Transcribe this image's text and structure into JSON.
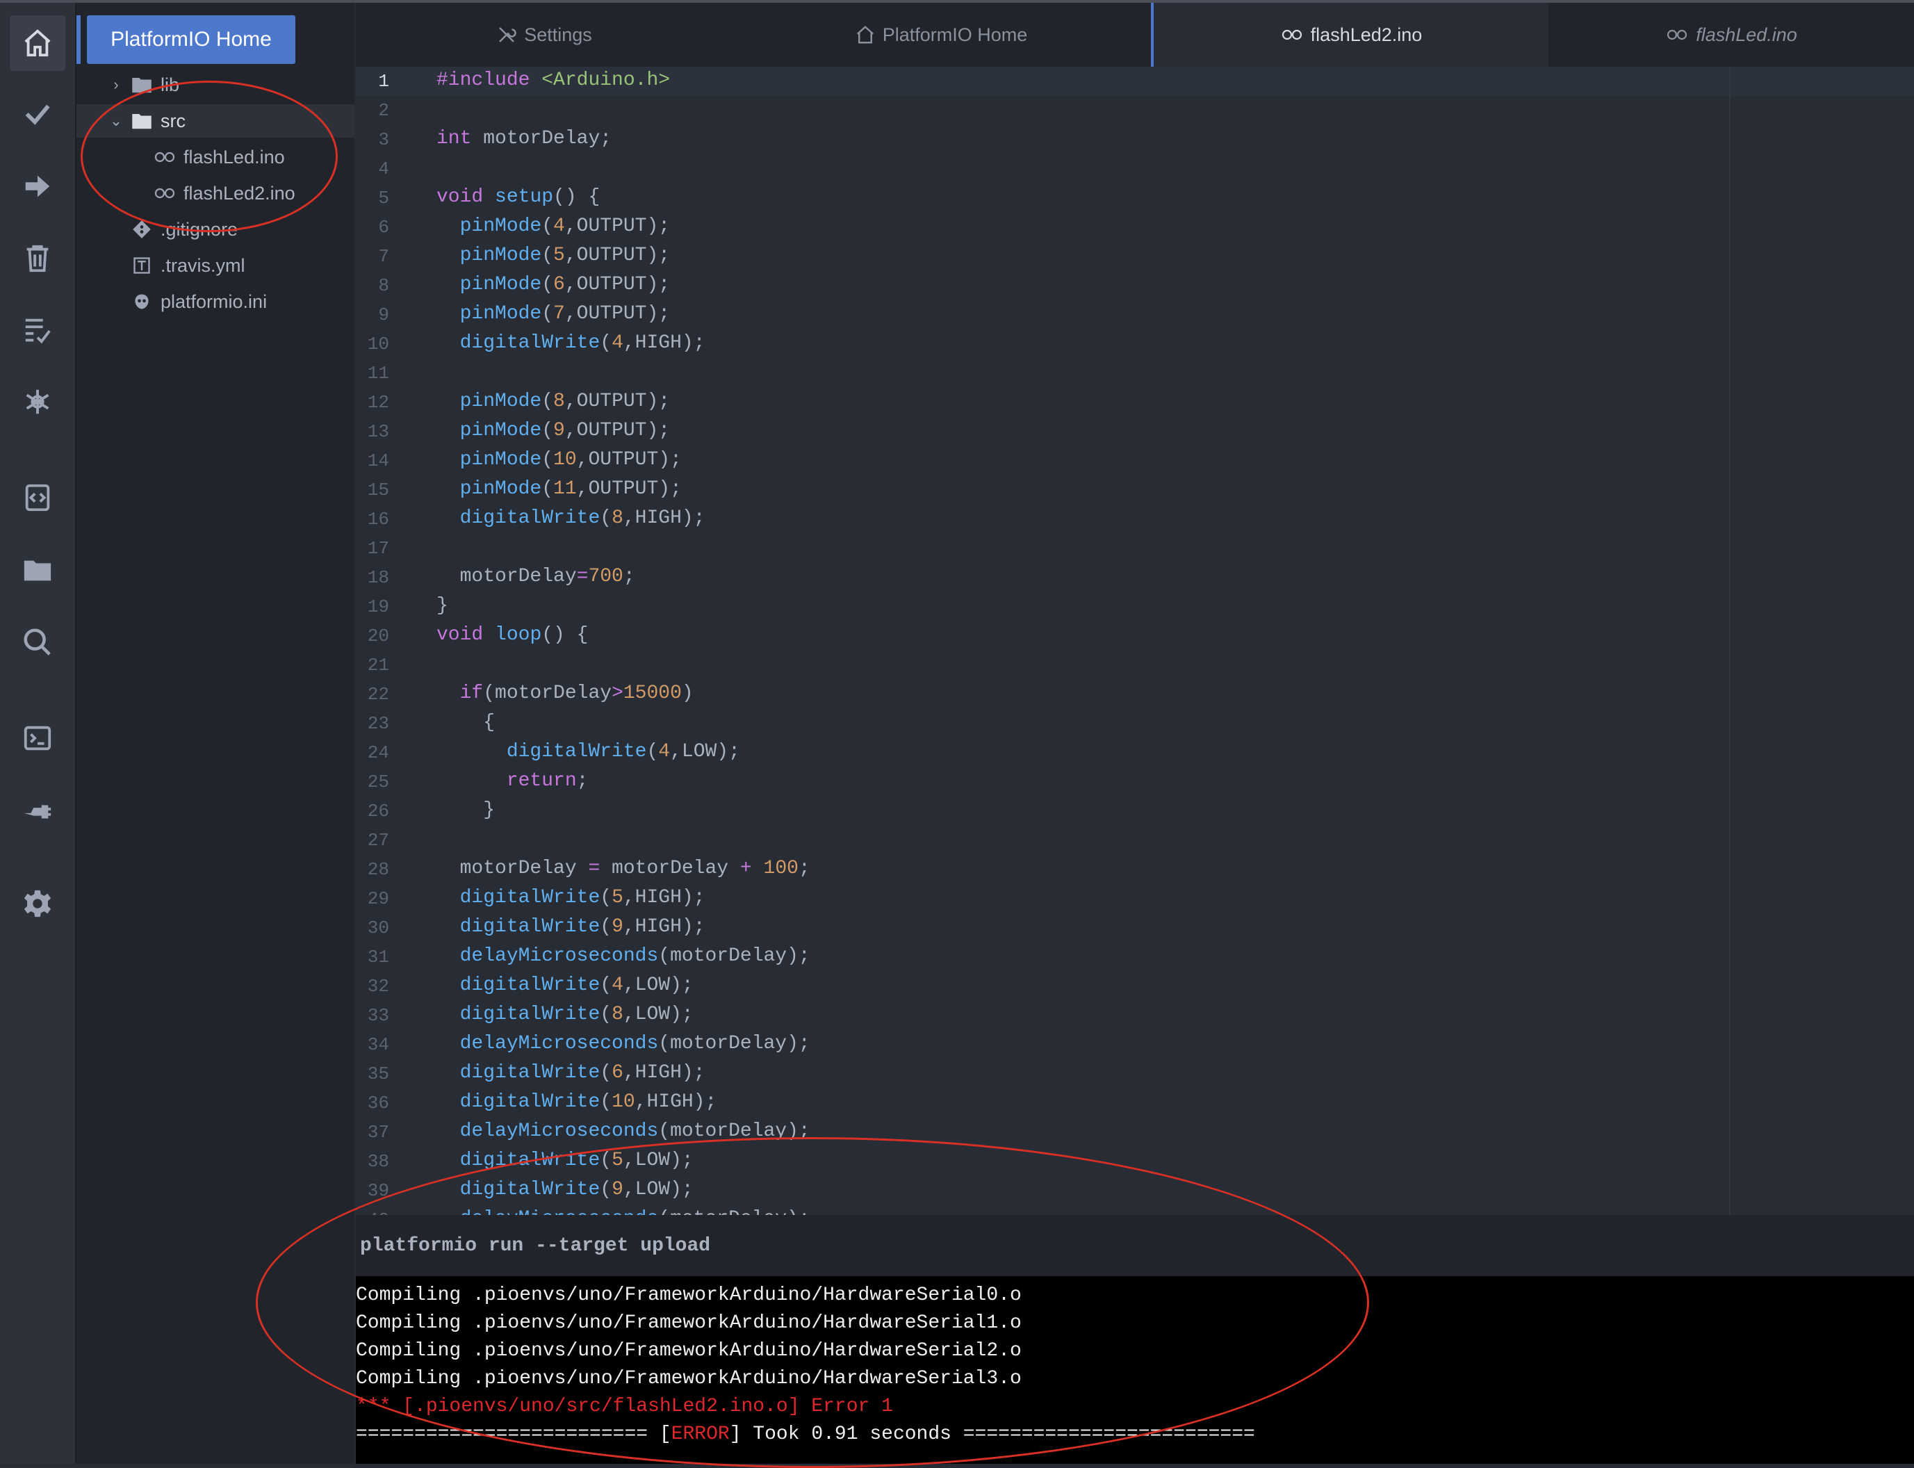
{
  "home_button": "PlatformIO Home",
  "tabs": [
    {
      "label": "Settings",
      "icon": "tools-icon"
    },
    {
      "label": "PlatformIO Home",
      "icon": "home-icon"
    },
    {
      "label": "flashLed2.ino",
      "icon": "infinity-icon",
      "active": true
    },
    {
      "label": "flashLed.ino",
      "icon": "infinity-icon"
    }
  ],
  "tree": {
    "lib": "lib",
    "src": "src",
    "file1": "flashLed.ino",
    "file2": "flashLed2.ino",
    "gitignore": ".gitignore",
    "travis": ".travis.yml",
    "ini": "platformio.ini"
  },
  "code_lines": [
    [
      {
        "t": "#include ",
        "c": "kw"
      },
      {
        "t": "<Arduino.h>",
        "c": "str"
      }
    ],
    [],
    [
      {
        "t": "int",
        "c": "kw"
      },
      {
        "t": " motorDelay;"
      }
    ],
    [],
    [
      {
        "t": "void",
        "c": "kw"
      },
      {
        "t": " "
      },
      {
        "t": "setup",
        "c": "fn"
      },
      {
        "t": "() {"
      }
    ],
    [
      {
        "t": "  "
      },
      {
        "t": "pinMode",
        "c": "fn"
      },
      {
        "t": "("
      },
      {
        "t": "4",
        "c": "num"
      },
      {
        "t": ",OUTPUT);"
      }
    ],
    [
      {
        "t": "  "
      },
      {
        "t": "pinMode",
        "c": "fn"
      },
      {
        "t": "("
      },
      {
        "t": "5",
        "c": "num"
      },
      {
        "t": ",OUTPUT);"
      }
    ],
    [
      {
        "t": "  "
      },
      {
        "t": "pinMode",
        "c": "fn"
      },
      {
        "t": "("
      },
      {
        "t": "6",
        "c": "num"
      },
      {
        "t": ",OUTPUT);"
      }
    ],
    [
      {
        "t": "  "
      },
      {
        "t": "pinMode",
        "c": "fn"
      },
      {
        "t": "("
      },
      {
        "t": "7",
        "c": "num"
      },
      {
        "t": ",OUTPUT);"
      }
    ],
    [
      {
        "t": "  "
      },
      {
        "t": "digitalWrite",
        "c": "fn"
      },
      {
        "t": "("
      },
      {
        "t": "4",
        "c": "num"
      },
      {
        "t": ",HIGH);"
      }
    ],
    [],
    [
      {
        "t": "  "
      },
      {
        "t": "pinMode",
        "c": "fn"
      },
      {
        "t": "("
      },
      {
        "t": "8",
        "c": "num"
      },
      {
        "t": ",OUTPUT);"
      }
    ],
    [
      {
        "t": "  "
      },
      {
        "t": "pinMode",
        "c": "fn"
      },
      {
        "t": "("
      },
      {
        "t": "9",
        "c": "num"
      },
      {
        "t": ",OUTPUT);"
      }
    ],
    [
      {
        "t": "  "
      },
      {
        "t": "pinMode",
        "c": "fn"
      },
      {
        "t": "("
      },
      {
        "t": "10",
        "c": "num"
      },
      {
        "t": ",OUTPUT);"
      }
    ],
    [
      {
        "t": "  "
      },
      {
        "t": "pinMode",
        "c": "fn"
      },
      {
        "t": "("
      },
      {
        "t": "11",
        "c": "num"
      },
      {
        "t": ",OUTPUT);"
      }
    ],
    [
      {
        "t": "  "
      },
      {
        "t": "digitalWrite",
        "c": "fn"
      },
      {
        "t": "("
      },
      {
        "t": "8",
        "c": "num"
      },
      {
        "t": ",HIGH);"
      }
    ],
    [],
    [
      {
        "t": "  motorDelay"
      },
      {
        "t": "=",
        "c": "op"
      },
      {
        "t": "700",
        "c": "num"
      },
      {
        "t": ";"
      }
    ],
    [
      {
        "t": "}"
      }
    ],
    [
      {
        "t": "void",
        "c": "kw"
      },
      {
        "t": " "
      },
      {
        "t": "loop",
        "c": "fn"
      },
      {
        "t": "() {"
      }
    ],
    [],
    [
      {
        "t": "  "
      },
      {
        "t": "if",
        "c": "kw"
      },
      {
        "t": "(motorDelay"
      },
      {
        "t": ">",
        "c": "op"
      },
      {
        "t": "15000",
        "c": "num"
      },
      {
        "t": ")"
      }
    ],
    [
      {
        "t": "    {"
      }
    ],
    [
      {
        "t": "      "
      },
      {
        "t": "digitalWrite",
        "c": "fn"
      },
      {
        "t": "("
      },
      {
        "t": "4",
        "c": "num"
      },
      {
        "t": ",LOW);"
      }
    ],
    [
      {
        "t": "      "
      },
      {
        "t": "return",
        "c": "kw"
      },
      {
        "t": ";"
      }
    ],
    [
      {
        "t": "    }"
      }
    ],
    [],
    [
      {
        "t": "  motorDelay "
      },
      {
        "t": "=",
        "c": "op"
      },
      {
        "t": " motorDelay "
      },
      {
        "t": "+",
        "c": "op"
      },
      {
        "t": " "
      },
      {
        "t": "100",
        "c": "num"
      },
      {
        "t": ";"
      }
    ],
    [
      {
        "t": "  "
      },
      {
        "t": "digitalWrite",
        "c": "fn"
      },
      {
        "t": "("
      },
      {
        "t": "5",
        "c": "num"
      },
      {
        "t": ",HIGH);"
      }
    ],
    [
      {
        "t": "  "
      },
      {
        "t": "digitalWrite",
        "c": "fn"
      },
      {
        "t": "("
      },
      {
        "t": "9",
        "c": "num"
      },
      {
        "t": ",HIGH);"
      }
    ],
    [
      {
        "t": "  "
      },
      {
        "t": "delayMicroseconds",
        "c": "fn"
      },
      {
        "t": "(motorDelay);"
      }
    ],
    [
      {
        "t": "  "
      },
      {
        "t": "digitalWrite",
        "c": "fn"
      },
      {
        "t": "("
      },
      {
        "t": "4",
        "c": "num"
      },
      {
        "t": ",LOW);"
      }
    ],
    [
      {
        "t": "  "
      },
      {
        "t": "digitalWrite",
        "c": "fn"
      },
      {
        "t": "("
      },
      {
        "t": "8",
        "c": "num"
      },
      {
        "t": ",LOW);"
      }
    ],
    [
      {
        "t": "  "
      },
      {
        "t": "delayMicroseconds",
        "c": "fn"
      },
      {
        "t": "(motorDelay);"
      }
    ],
    [
      {
        "t": "  "
      },
      {
        "t": "digitalWrite",
        "c": "fn"
      },
      {
        "t": "("
      },
      {
        "t": "6",
        "c": "num"
      },
      {
        "t": ",HIGH);"
      }
    ],
    [
      {
        "t": "  "
      },
      {
        "t": "digitalWrite",
        "c": "fn"
      },
      {
        "t": "("
      },
      {
        "t": "10",
        "c": "num"
      },
      {
        "t": ",HIGH);"
      }
    ],
    [
      {
        "t": "  "
      },
      {
        "t": "delayMicroseconds",
        "c": "fn"
      },
      {
        "t": "(motorDelay);"
      }
    ],
    [
      {
        "t": "  "
      },
      {
        "t": "digitalWrite",
        "c": "fn"
      },
      {
        "t": "("
      },
      {
        "t": "5",
        "c": "num"
      },
      {
        "t": ",LOW);"
      }
    ],
    [
      {
        "t": "  "
      },
      {
        "t": "digitalWrite",
        "c": "fn"
      },
      {
        "t": "("
      },
      {
        "t": "9",
        "c": "num"
      },
      {
        "t": ",LOW);"
      }
    ],
    [
      {
        "t": "  "
      },
      {
        "t": "delayMicroseconds",
        "c": "fn"
      },
      {
        "t": "(motorDelay);"
      }
    ]
  ],
  "terminal": {
    "command": "platformio run --target upload",
    "lines": [
      "Compiling .pioenvs/uno/FrameworkArduino/HardwareSerial0.o",
      "Compiling .pioenvs/uno/FrameworkArduino/HardwareSerial1.o",
      "Compiling .pioenvs/uno/FrameworkArduino/HardwareSerial2.o",
      "Compiling .pioenvs/uno/FrameworkArduino/HardwareSerial3.o"
    ],
    "error_line": "*** [.pioenvs/uno/src/flashLed2.ino.o] Error 1",
    "summary_left": "========================= [",
    "summary_error": "ERROR",
    "summary_right": "] Took 0.91 seconds ========================="
  },
  "colors": {
    "accent": "#4d78cc",
    "annotation": "#d93025",
    "error": "#e0272b"
  }
}
